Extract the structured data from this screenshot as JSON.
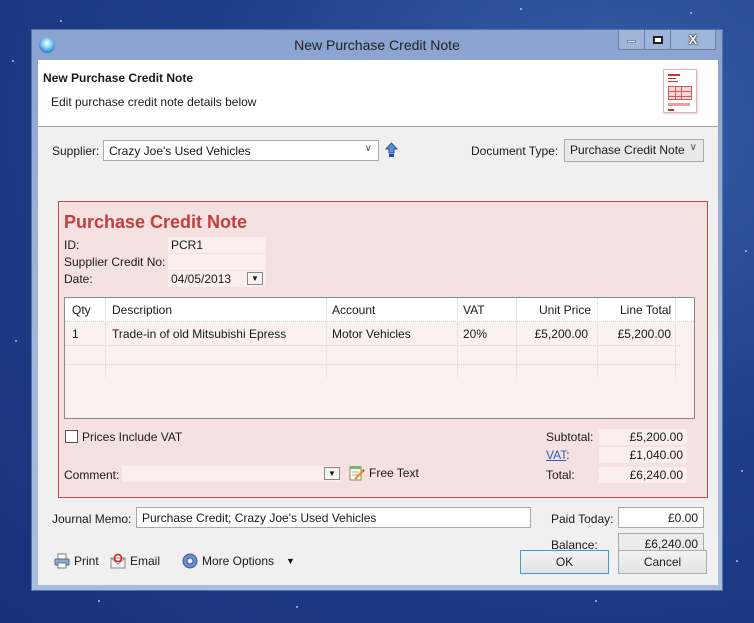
{
  "window": {
    "title": "New Purchase Credit Note",
    "controls": {
      "minimize": "minimize",
      "maximize": "maximize",
      "close": "X"
    }
  },
  "header": {
    "title": "New Purchase Credit Note",
    "subtitle": "Edit purchase credit note details below",
    "icon": "credit-note-document-icon"
  },
  "supplier": {
    "label": "Supplier:",
    "value": "Crazy Joe's Used Vehicles"
  },
  "document_type": {
    "label": "Document Type:",
    "value": "Purchase Credit Note"
  },
  "panel": {
    "title": "Purchase Credit Note",
    "id_label": "ID:",
    "id_value": "PCR1",
    "supplier_credit_label": "Supplier Credit No:",
    "supplier_credit_value": "",
    "date_label": "Date:",
    "date_value": "04/05/2013"
  },
  "lines": {
    "columns": [
      "Qty",
      "Description",
      "Account",
      "VAT",
      "Unit Price",
      "Line Total"
    ],
    "rows": [
      {
        "qty": "1",
        "description": "Trade-in of old Mitsubishi Epress",
        "account": "Motor Vehicles",
        "vat": "20%",
        "unit_price": "£5,200.00",
        "line_total": "£5,200.00"
      }
    ]
  },
  "prices_include_vat": {
    "label": "Prices Include VAT",
    "checked": false
  },
  "comment": {
    "label": "Comment:",
    "value": "",
    "free_text_label": "Free Text"
  },
  "totals": {
    "subtotal_label": "Subtotal:",
    "subtotal": "£5,200.00",
    "vat_label": "VAT",
    "vat_colon": ":",
    "vat": "£1,040.00",
    "total_label": "Total:",
    "total": "£6,240.00"
  },
  "journal_memo": {
    "label": "Journal Memo:",
    "value": "Purchase Credit; Crazy Joe's Used Vehicles"
  },
  "paid_today": {
    "label": "Paid Today:",
    "value": "£0.00"
  },
  "balance": {
    "label": "Balance:",
    "value": "£6,240.00"
  },
  "toolbar": {
    "print_label": "Print",
    "email_label": "Email",
    "more_options_label": "More Options"
  },
  "buttons": {
    "ok_label": "OK",
    "cancel_label": "Cancel"
  },
  "colors": {
    "panel_background": "#f6e1e1",
    "panel_border": "#c24a4a",
    "panel_title": "#c0403f",
    "link": "#2a62b5",
    "default_button_border": "#3c9ad8"
  }
}
